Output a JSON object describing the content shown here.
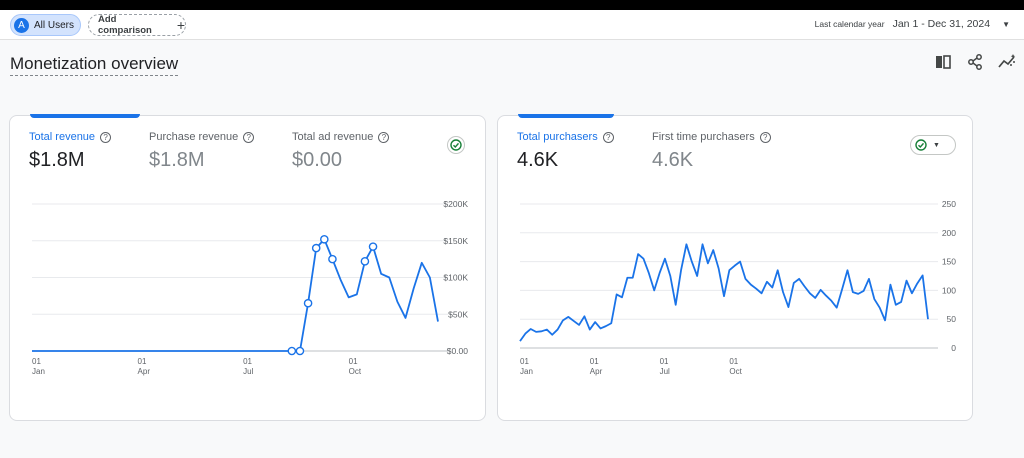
{
  "filter": {
    "segment_badge": "A",
    "segment_label": "All Users",
    "add_comparison": "Add comparison",
    "date_label": "Last calendar year",
    "date_range": "Jan 1 - Dec 31, 2024"
  },
  "page": {
    "title": "Monetization overview"
  },
  "colors": {
    "accent": "#1a73e8",
    "check": "#188038"
  },
  "cards": [
    {
      "metrics": [
        {
          "label": "Total revenue",
          "value": "$1.8M",
          "active": true
        },
        {
          "label": "Purchase revenue",
          "value": "$1.8M",
          "active": false
        },
        {
          "label": "Total ad revenue",
          "value": "$0.00",
          "active": false
        }
      ],
      "chart_data": {
        "type": "line",
        "y_ticks": [
          "$200K",
          "$150K",
          "$100K",
          "$50K",
          "$0.00"
        ],
        "y_tick_values": [
          200000,
          150000,
          100000,
          50000,
          0
        ],
        "ylim": [
          0,
          200000
        ],
        "x_ticks": [
          [
            "01",
            "Jan"
          ],
          [
            "01",
            "Apr"
          ],
          [
            "01",
            "Jul"
          ],
          [
            "01",
            "Oct"
          ]
        ],
        "x_tick_index": [
          0,
          13,
          26,
          39
        ],
        "values": [
          0,
          0,
          0,
          0,
          0,
          0,
          0,
          0,
          0,
          0,
          0,
          0,
          0,
          0,
          0,
          0,
          0,
          0,
          0,
          0,
          0,
          0,
          0,
          0,
          0,
          0,
          0,
          0,
          0,
          0,
          0,
          0,
          0,
          0,
          65000,
          140000,
          152000,
          125000,
          97000,
          73000,
          77000,
          122000,
          142000,
          105000,
          100000,
          67000,
          45000,
          85000,
          120000,
          100000,
          40000
        ],
        "markers": [
          32,
          33,
          34,
          35,
          36,
          37,
          41,
          42
        ]
      }
    },
    {
      "metrics": [
        {
          "label": "Total purchasers",
          "value": "4.6K",
          "active": true
        },
        {
          "label": "First time purchasers",
          "value": "4.6K",
          "active": false
        }
      ],
      "chart_data": {
        "type": "line",
        "y_ticks": [
          "250",
          "200",
          "150",
          "100",
          "50",
          "0"
        ],
        "y_tick_values": [
          250,
          200,
          150,
          100,
          50,
          0
        ],
        "ylim": [
          0,
          250
        ],
        "x_ticks": [
          [
            "01",
            "Jan"
          ],
          [
            "01",
            "Apr"
          ],
          [
            "01",
            "Jul"
          ],
          [
            "01",
            "Oct"
          ]
        ],
        "x_tick_index": [
          0,
          13,
          26,
          39
        ],
        "values": [
          12,
          25,
          33,
          28,
          29,
          32,
          23,
          32,
          48,
          54,
          47,
          40,
          55,
          32,
          45,
          34,
          38,
          43,
          93,
          88,
          122,
          122,
          163,
          155,
          130,
          100,
          130,
          155,
          125,
          75,
          135,
          180,
          150,
          125,
          180,
          147,
          170,
          138,
          90,
          135,
          143,
          150,
          120,
          110,
          103,
          95,
          115,
          105,
          135,
          97,
          71,
          113,
          120,
          107,
          95,
          87,
          101,
          91,
          82,
          70,
          102,
          135,
          97,
          94,
          99,
          120,
          85,
          70,
          48,
          110,
          75,
          80,
          117,
          95,
          112,
          126,
          50
        ]
      }
    }
  ]
}
